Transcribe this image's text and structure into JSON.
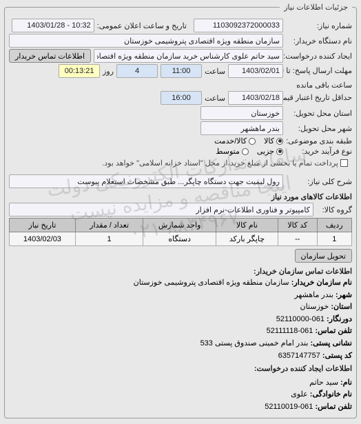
{
  "watermark_line1": "سامانه تدارکات الکترونیکی دولت",
  "watermark_line2": "اینجا مناقصه و مزایده نیست",
  "watermark_phone": "۰۲۱-۸۸۳۴۹۶۷",
  "legend_main": "جزئیات اطلاعات نیاز",
  "labels": {
    "need_no": "شماره نیاز:",
    "announce_time": "تاریخ و ساعت اعلان عمومی:",
    "buyer_org": "نام دستگاه خریدار:",
    "requester": "ایجاد کننده درخواست:",
    "contact_btn": "اطلاعات تماس خریدار",
    "answer_deadline": "مهلت ارسال پاسخ: تا تاریخ:",
    "saat": "ساعت",
    "roz": "روز",
    "remain": "ساعت باقی مانده",
    "validity_to": "حداقل تاریخ اعتبار قیمت: تا تاریخ:",
    "delivery_prov": "استان محل تحویل:",
    "delivery_city": "شهر محل تحویل:",
    "subject_type": "طبقه بندی موضوعی:",
    "kala": "کالا",
    "khadamat": "کالا/خدمت",
    "buy_process": "نوع فرآیند خرید:",
    "radio_partial": "جزیی",
    "radio_mid": "متوسط",
    "settlement_note": "پرداخت تمام یا بخشی از مبلغ خرید،از محل \"اسناد خزانه اسلامی\" خواهد بود.",
    "need_desc": "شرح کلی نیاز:",
    "items_title": "اطلاعات کالاهای مورد نیاز",
    "group": "گروه کالا:",
    "org_delivery_btn": "تحویل سازمان",
    "contact_title": "اطلاعات تماس سازمان خریدار:",
    "org_name_l": "نام سازمان خریدار:",
    "city_l": "شهر:",
    "province_l": "استان:",
    "fax_l": "دورنگار:",
    "phone_l": "تلفن تماس:",
    "postal_l": "نشانی پستی:",
    "postcode_l": "کد پستی:",
    "requester_title": "اطلاعات ایجاد کننده درخواست:",
    "name_l": "نام:",
    "lname_l": "نام خانوادگی:",
    "phone2_l": "تلفن تماس:"
  },
  "values": {
    "need_no": "1103092372000033",
    "announce_time": "10:32 - 1403/01/28",
    "buyer_org": "سازمان منطقه ویژه اقتصادی پتروشیمی خوزستان",
    "requester": "سید حاتم علوی کارشناس خرید سازمان منطقه ویژه اقتصادی پتروشیمی خوزس",
    "answer_date": "1403/02/01",
    "answer_time": "11:00",
    "answer_days": "4",
    "answer_remain": "00:13:21",
    "validity_date": "1403/02/18",
    "validity_time": "16:00",
    "province": "خوزستان",
    "city": "بندر ماهشهر",
    "need_desc": "رول لیمیت جهت دستگاه چاپگر... طبق مشخصات استعلام پیوست",
    "group": "کامپیوتر و فناوری اطلاعات-نرم افزار"
  },
  "table": {
    "headers": [
      "ردیف",
      "کد کالا",
      "نام کالا",
      "واحد شمارش",
      "تعداد / مقدار",
      "تاریخ نیاز"
    ],
    "rows": [
      [
        "1",
        "--",
        "چاپگر بارکد",
        "دستگاه",
        "1",
        "1403/02/03"
      ]
    ]
  },
  "contact": {
    "org_name": "سازمان منطقه ویژه اقتصادی پتروشیمی خوزستان",
    "city": "بندر ماهشهر",
    "province": "خوزستان",
    "fax": "061-52110000",
    "phone": "061-52111118",
    "postal": "بندر امام خمینی صندوق پستی 533",
    "postcode": "6357147757",
    "req_name": "سید حاتم",
    "req_lname": "علوی",
    "req_phone": "061-52110019"
  }
}
